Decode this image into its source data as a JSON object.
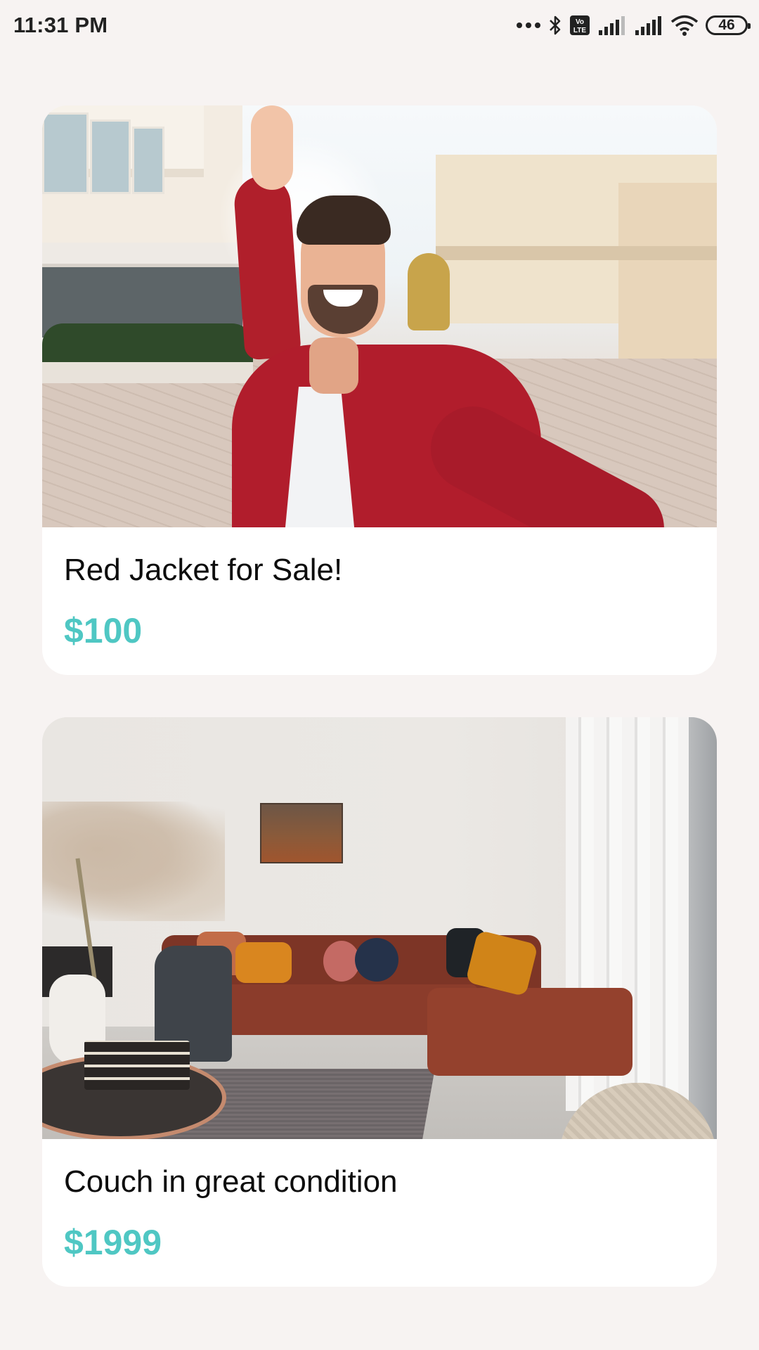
{
  "status_bar": {
    "time": "11:31 PM",
    "battery": "46",
    "icons": [
      "more-dots-icon",
      "bluetooth-icon",
      "volte-icon",
      "signal-icon",
      "signal-icon",
      "wifi-icon",
      "battery-icon"
    ]
  },
  "listings": [
    {
      "title": "Red Jacket for Sale!",
      "price": "$100"
    },
    {
      "title": "Couch in great condition",
      "price": "$1999"
    }
  ],
  "colors": {
    "background": "#f7f3f2",
    "card": "#ffffff",
    "price": "#4fc7c3",
    "title": "#0d0d0d"
  }
}
